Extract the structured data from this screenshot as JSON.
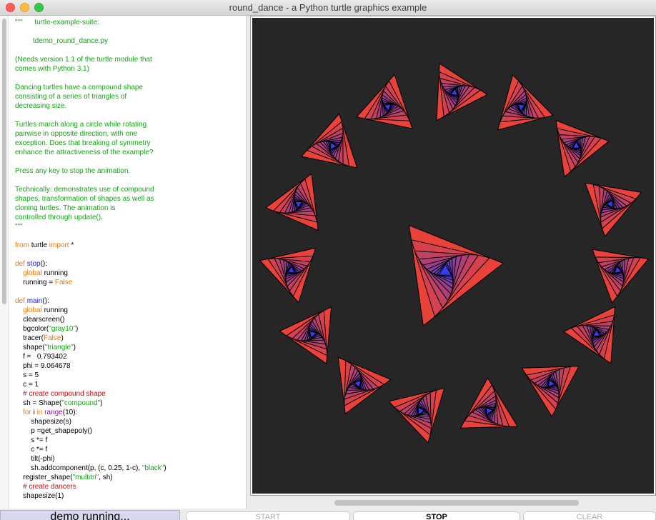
{
  "window": {
    "title": "round_dance - a Python turtle graphics example"
  },
  "editor": {
    "lines": [
      [
        {
          "t": "\"\"\"      turtle-example-suite:",
          "c": "str"
        }
      ],
      [
        {
          "t": "",
          "c": ""
        }
      ],
      [
        {
          "t": "         tdemo_round_dance.py",
          "c": "str"
        }
      ],
      [
        {
          "t": "",
          "c": ""
        }
      ],
      [
        {
          "t": "(Needs version 1.1 of the turtle module that",
          "c": "str"
        }
      ],
      [
        {
          "t": "comes with Python 3.1)",
          "c": "str"
        }
      ],
      [
        {
          "t": "",
          "c": ""
        }
      ],
      [
        {
          "t": "Dancing turtles have a compound shape",
          "c": "str"
        }
      ],
      [
        {
          "t": "consisting of a series of triangles of",
          "c": "str"
        }
      ],
      [
        {
          "t": "decreasing size.",
          "c": "str"
        }
      ],
      [
        {
          "t": "",
          "c": ""
        }
      ],
      [
        {
          "t": "Turtles march along a circle while rotating",
          "c": "str"
        }
      ],
      [
        {
          "t": "pairwise in opposite direction, with one",
          "c": "str"
        }
      ],
      [
        {
          "t": "exception. Does that breaking of symmetry",
          "c": "str"
        }
      ],
      [
        {
          "t": "enhance the attractiveness of the example?",
          "c": "str"
        }
      ],
      [
        {
          "t": "",
          "c": ""
        }
      ],
      [
        {
          "t": "Press any key to stop the animation.",
          "c": "str"
        }
      ],
      [
        {
          "t": "",
          "c": ""
        }
      ],
      [
        {
          "t": "Technically: demonstrates use of compound",
          "c": "str"
        }
      ],
      [
        {
          "t": "shapes, transformation of shapes as well as",
          "c": "str"
        }
      ],
      [
        {
          "t": "cloning turtles. The animation is",
          "c": "str"
        }
      ],
      [
        {
          "t": "controlled through update().",
          "c": "str"
        }
      ],
      [
        {
          "t": "\"\"\"",
          "c": "str"
        }
      ],
      [
        {
          "t": "",
          "c": ""
        }
      ],
      [
        {
          "t": "from",
          "c": "kw"
        },
        {
          "t": " turtle ",
          "c": ""
        },
        {
          "t": "import",
          "c": "kw"
        },
        {
          "t": " *",
          "c": ""
        }
      ],
      [
        {
          "t": "",
          "c": ""
        }
      ],
      [
        {
          "t": "def",
          "c": "kw"
        },
        {
          "t": " ",
          "c": ""
        },
        {
          "t": "stop",
          "c": "def"
        },
        {
          "t": "():",
          "c": ""
        }
      ],
      [
        {
          "t": "    ",
          "c": ""
        },
        {
          "t": "global",
          "c": "kw"
        },
        {
          "t": " running",
          "c": ""
        }
      ],
      [
        {
          "t": "    running = ",
          "c": ""
        },
        {
          "t": "False",
          "c": "kw"
        }
      ],
      [
        {
          "t": "",
          "c": ""
        }
      ],
      [
        {
          "t": "def",
          "c": "kw"
        },
        {
          "t": " ",
          "c": ""
        },
        {
          "t": "main",
          "c": "def"
        },
        {
          "t": "():",
          "c": ""
        }
      ],
      [
        {
          "t": "    ",
          "c": ""
        },
        {
          "t": "global",
          "c": "kw"
        },
        {
          "t": " running",
          "c": ""
        }
      ],
      [
        {
          "t": "    clearscreen()",
          "c": ""
        }
      ],
      [
        {
          "t": "    bgcolor(",
          "c": ""
        },
        {
          "t": "\"gray10\"",
          "c": "str"
        },
        {
          "t": ")",
          "c": ""
        }
      ],
      [
        {
          "t": "    tracer(",
          "c": ""
        },
        {
          "t": "False",
          "c": "kw"
        },
        {
          "t": ")",
          "c": ""
        }
      ],
      [
        {
          "t": "    shape(",
          "c": ""
        },
        {
          "t": "\"triangle\"",
          "c": "str"
        },
        {
          "t": ")",
          "c": ""
        }
      ],
      [
        {
          "t": "    f =   0.793402",
          "c": ""
        }
      ],
      [
        {
          "t": "    phi = 9.064678",
          "c": ""
        }
      ],
      [
        {
          "t": "    s = 5",
          "c": ""
        }
      ],
      [
        {
          "t": "    c = 1",
          "c": ""
        }
      ],
      [
        {
          "t": "    # create compound shape",
          "c": "cmt"
        }
      ],
      [
        {
          "t": "    sh = Shape(",
          "c": ""
        },
        {
          "t": "\"compound\"",
          "c": "str"
        },
        {
          "t": ")",
          "c": ""
        }
      ],
      [
        {
          "t": "    ",
          "c": ""
        },
        {
          "t": "for",
          "c": "kw"
        },
        {
          "t": " i ",
          "c": ""
        },
        {
          "t": "in",
          "c": "kw"
        },
        {
          "t": " ",
          "c": ""
        },
        {
          "t": "range",
          "c": "builtin"
        },
        {
          "t": "(10):",
          "c": ""
        }
      ],
      [
        {
          "t": "        shapesize(s)",
          "c": ""
        }
      ],
      [
        {
          "t": "        p =get_shapepoly()",
          "c": ""
        }
      ],
      [
        {
          "t": "        s *= f",
          "c": ""
        }
      ],
      [
        {
          "t": "        c *= f",
          "c": ""
        }
      ],
      [
        {
          "t": "        tilt(-phi)",
          "c": ""
        }
      ],
      [
        {
          "t": "        sh.addcomponent(p, (c, 0.25, 1-c), ",
          "c": ""
        },
        {
          "t": "\"black\"",
          "c": "str"
        },
        {
          "t": ")",
          "c": ""
        }
      ],
      [
        {
          "t": "    register_shape(",
          "c": ""
        },
        {
          "t": "\"multitri\"",
          "c": "str"
        },
        {
          "t": ", sh)",
          "c": ""
        }
      ],
      [
        {
          "t": "    # create dancers",
          "c": "cmt"
        }
      ],
      [
        {
          "t": "    shapesize(1)",
          "c": ""
        }
      ]
    ]
  },
  "canvas": {
    "background": "#262626",
    "outer_color": "#e8423a",
    "inner_color": "#3a3cf0",
    "outline": "#000000"
  },
  "status": {
    "label": "demo running..."
  },
  "buttons": {
    "start": "START",
    "stop": "STOP",
    "clear": "CLEAR"
  }
}
